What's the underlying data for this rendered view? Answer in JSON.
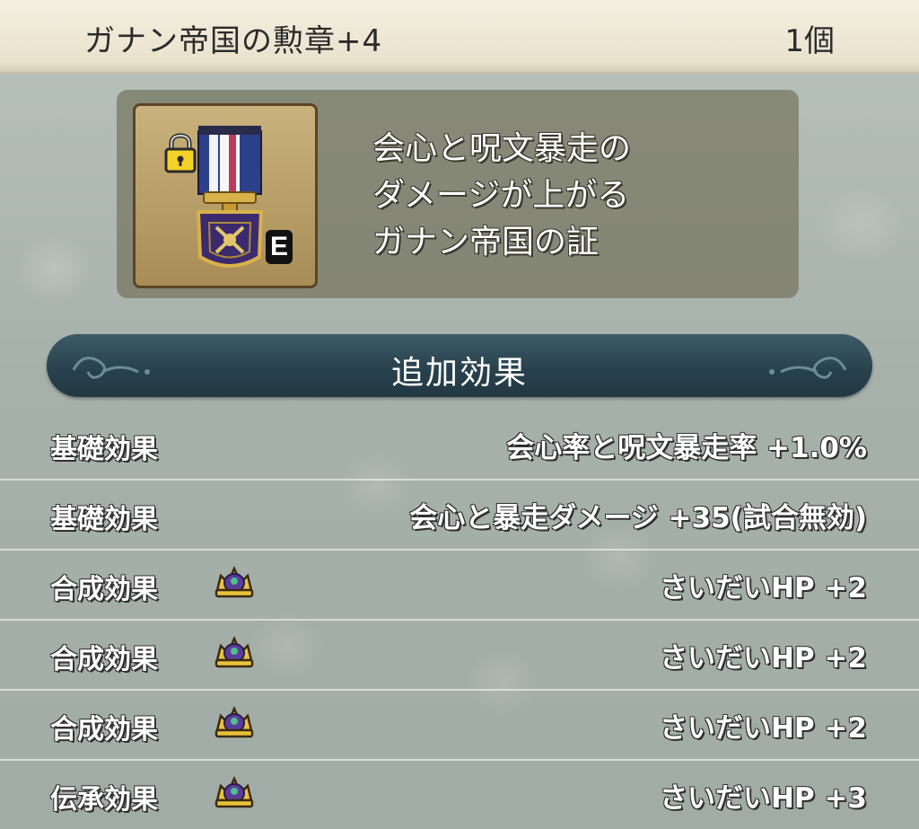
{
  "header": {
    "item_name": "ガナン帝国の勲章+4",
    "item_count": "1個"
  },
  "item": {
    "icon": "medal-icon",
    "lock_icon": "padlock-icon",
    "equipped_badge": "E",
    "description_lines": [
      "会心と呪文暴走の",
      "ダメージが上がる",
      "ガナン帝国の証"
    ]
  },
  "section": {
    "title": "追加効果"
  },
  "effects": [
    {
      "label": "基礎効果",
      "value": "会心率と呪文暴走率 +1.0%",
      "icon": null
    },
    {
      "label": "基礎効果",
      "value": "会心と暴走ダメージ +35(試合無効)",
      "icon": null
    },
    {
      "label": "合成効果",
      "value": "さいだいHP +2",
      "icon": "crown-icon"
    },
    {
      "label": "合成効果",
      "value": "さいだいHP +2",
      "icon": "crown-icon"
    },
    {
      "label": "合成効果",
      "value": "さいだいHP +2",
      "icon": "crown-icon"
    },
    {
      "label": "伝承効果",
      "value": "さいだいHP +3",
      "icon": "crown-icon"
    }
  ],
  "colors": {
    "header_bg": "#efe9d7",
    "section_bar": "#2c4752",
    "desc_panel": "#767460",
    "medal_ribbon_blue": "#2c3f8a",
    "medal_shield": "#3c2a6e"
  }
}
